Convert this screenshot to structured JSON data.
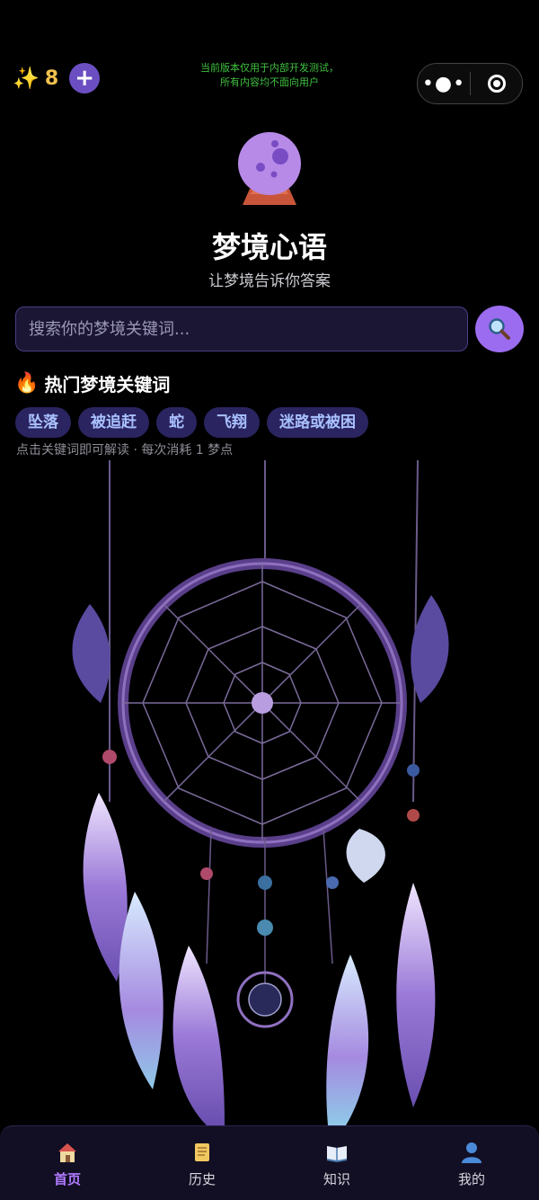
{
  "topbar": {
    "sparkle_icon": "sparkle-icon",
    "points": "8",
    "add_label": "+",
    "dev_notice_line1": "当前版本仅用于内部开发测试，",
    "dev_notice_line2": "所有内容均不面向用户",
    "capsule_more": "•●•"
  },
  "app": {
    "title": "梦境心语",
    "subtitle": "让梦境告诉你答案"
  },
  "search": {
    "placeholder": "搜索你的梦境关键词...",
    "value": ""
  },
  "hot": {
    "title": "热门梦境关键词",
    "tags": [
      "坠落",
      "被追赶",
      "蛇",
      "飞翔",
      "迷路或被困"
    ],
    "hint": "点击关键词即可解读 · 每次消耗 1 梦点"
  },
  "tabbar": {
    "items": [
      {
        "label": "首页",
        "icon": "home-icon",
        "active": true
      },
      {
        "label": "历史",
        "icon": "scroll-icon",
        "active": false
      },
      {
        "label": "知识",
        "icon": "book-icon",
        "active": false
      },
      {
        "label": "我的",
        "icon": "user-icon",
        "active": false
      }
    ]
  },
  "colors": {
    "accent": "#9b6cf0",
    "tag_bg": "#2a2460",
    "tag_text": "#a9c0ff",
    "points": "#f2c14e",
    "notice": "#3fc03f"
  }
}
